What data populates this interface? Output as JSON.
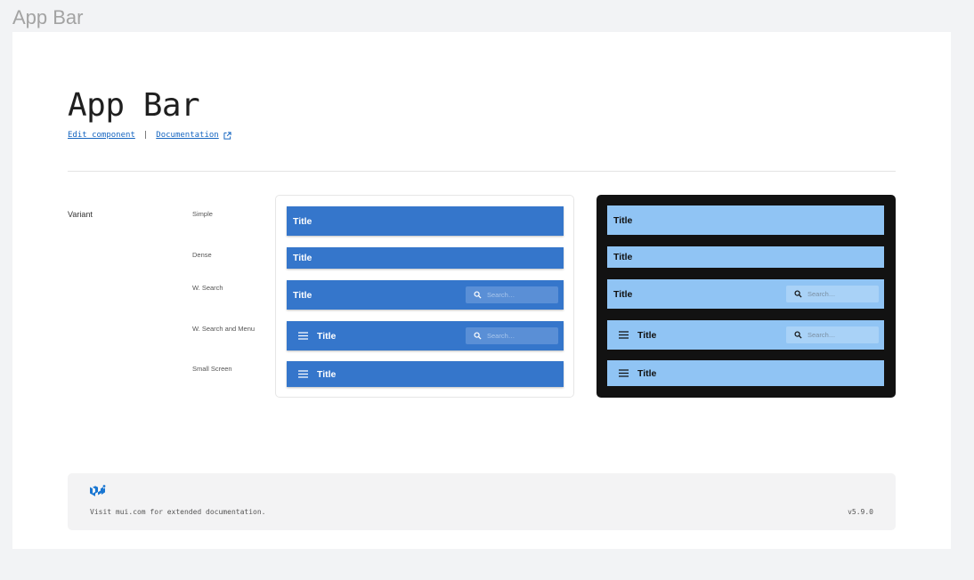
{
  "frame": {
    "label": "App Bar"
  },
  "header": {
    "title": "App Bar",
    "edit_link": "Edit component",
    "separator": "|",
    "docs_link": "Documentation"
  },
  "property": {
    "label": "Variant"
  },
  "variants": [
    "Simple",
    "Dense",
    "W. Search",
    "W. Search and Menu",
    "Small Screen"
  ],
  "bars": {
    "title": "Title",
    "search_placeholder": "Search…"
  },
  "footer": {
    "visit_text": "Visit mui.com for extended documentation.",
    "version": "v5.9.0"
  },
  "colors": {
    "light_bar": "#3576cb",
    "dark_bar": "#90c4f4",
    "dark_panel": "#121212",
    "link": "#1565c0",
    "logo": "#1976d2"
  },
  "icons": [
    "external-link-icon",
    "menu-icon",
    "search-icon",
    "mui-logo"
  ]
}
